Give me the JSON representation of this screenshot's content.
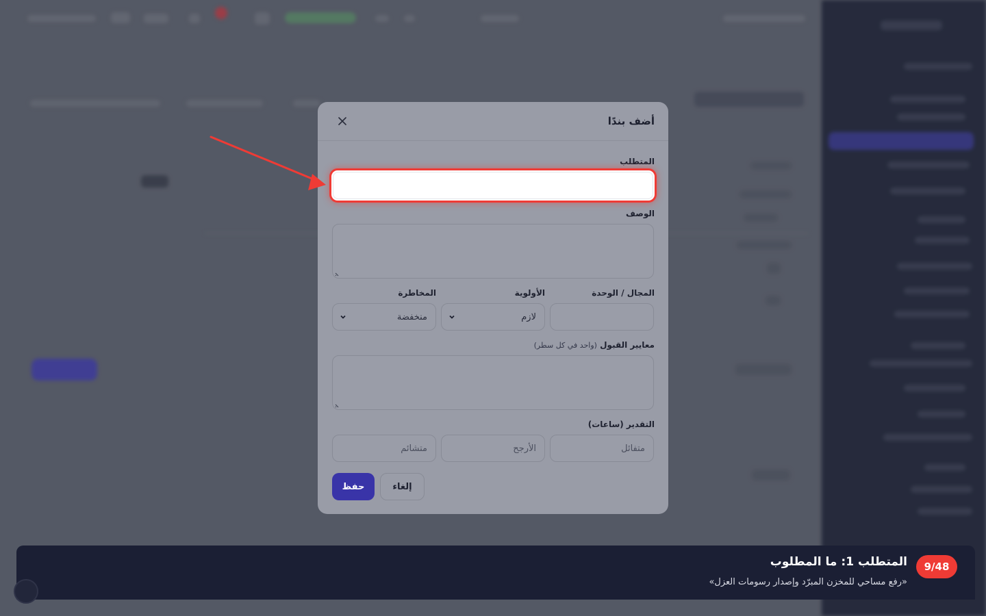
{
  "modal": {
    "title": "أضف بندًا",
    "close_icon": "close-icon",
    "fields": {
      "requirement_label": "المتطلب",
      "requirement_value": "",
      "description_label": "الوصف",
      "domain_label": "المجال / الوحدة",
      "domain_value": "",
      "priority_label": "الأولوية",
      "priority_value": "لازم",
      "risk_label": "المخاطرة",
      "risk_value": "منخفضة",
      "acceptance_label": "معايير القبول",
      "acceptance_hint": "(واحد في كل سطر)",
      "estimate_label": "التقدير (ساعات)",
      "optimistic_placeholder": "متفائل",
      "likely_placeholder": "الأرجح",
      "pessimistic_placeholder": "متشائم"
    },
    "buttons": {
      "cancel": "إلغاء",
      "save": "حفظ"
    }
  },
  "banner": {
    "step": "9/48",
    "title": "المتطلب 1: ما المطلوب",
    "subtitle": "«رفع مساحي للمخزن المبرّد وإصدار رسومات العزل»"
  },
  "colors": {
    "highlight": "#ef3b35",
    "primary": "#3934a8",
    "banner_bg": "#1b1f34"
  }
}
